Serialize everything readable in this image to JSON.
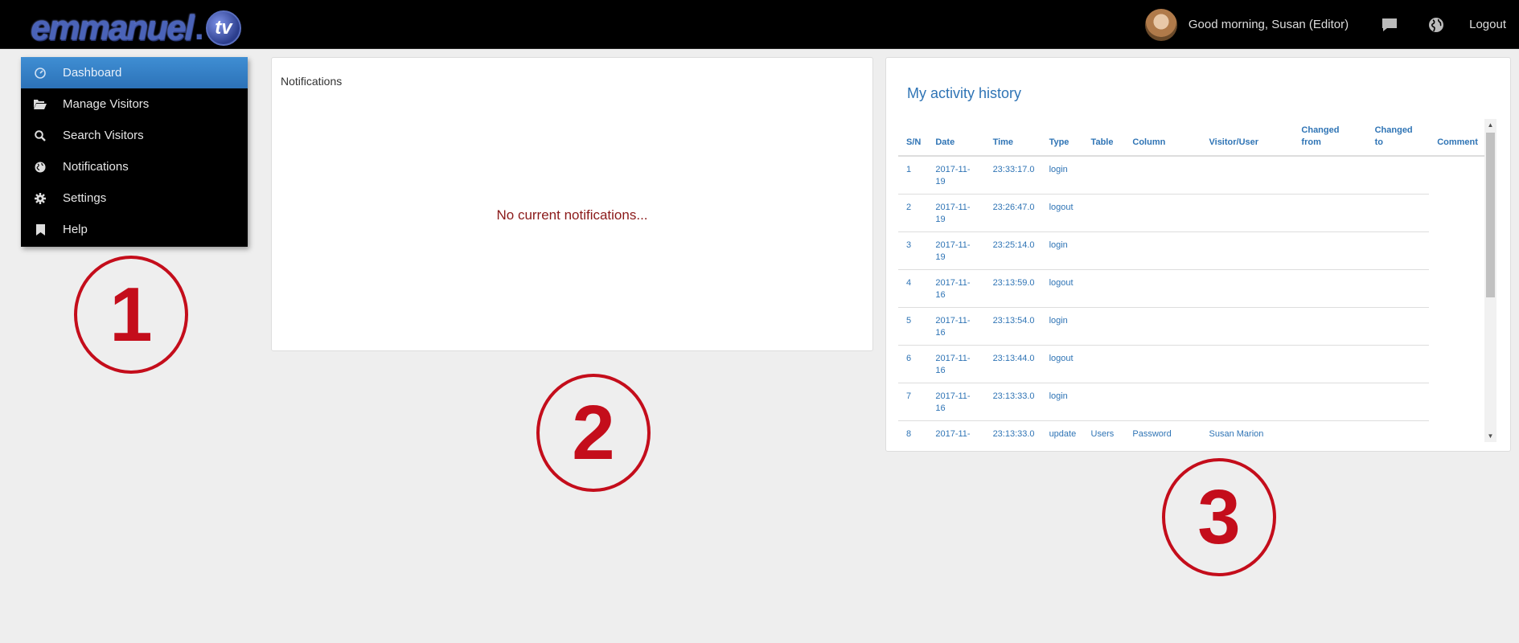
{
  "brand": {
    "name": "emmanuel",
    "suffix": "tv"
  },
  "header": {
    "greeting": "Good morning, Susan (Editor)",
    "logout": "Logout"
  },
  "sidebar": {
    "items": [
      {
        "label": "Dashboard",
        "icon": "dashboard-icon",
        "active": true
      },
      {
        "label": "Manage Visitors",
        "icon": "folder-open-icon"
      },
      {
        "label": "Search Visitors",
        "icon": "search-icon"
      },
      {
        "label": "Notifications",
        "icon": "globe-icon"
      },
      {
        "label": "Settings",
        "icon": "gear-icon"
      },
      {
        "label": "Help",
        "icon": "bookmark-icon"
      }
    ]
  },
  "notifications": {
    "title": "Notifications",
    "empty_message": "No current notifications..."
  },
  "activity": {
    "title": "My activity history",
    "columns": [
      "S/N",
      "Date",
      "Time",
      "Type",
      "Table",
      "Column",
      "Visitor/User",
      "Changed from",
      "Changed to",
      "Comment"
    ],
    "rows": [
      [
        "1",
        "2017-11-19",
        "23:33:17.0",
        "login",
        "",
        "",
        "",
        "",
        "",
        ""
      ],
      [
        "2",
        "2017-11-19",
        "23:26:47.0",
        "logout",
        "",
        "",
        "",
        "",
        "",
        ""
      ],
      [
        "3",
        "2017-11-19",
        "23:25:14.0",
        "login",
        "",
        "",
        "",
        "",
        "",
        ""
      ],
      [
        "4",
        "2017-11-16",
        "23:13:59.0",
        "logout",
        "",
        "",
        "",
        "",
        "",
        ""
      ],
      [
        "5",
        "2017-11-16",
        "23:13:54.0",
        "login",
        "",
        "",
        "",
        "",
        "",
        ""
      ],
      [
        "6",
        "2017-11-16",
        "23:13:44.0",
        "logout",
        "",
        "",
        "",
        "",
        "",
        ""
      ],
      [
        "7",
        "2017-11-16",
        "23:13:33.0",
        "login",
        "",
        "",
        "",
        "",
        "",
        ""
      ],
      [
        "8",
        "2017-11-",
        "23:13:33.0",
        "update",
        "Users",
        "Password",
        "Susan Marion",
        "",
        "",
        ""
      ]
    ]
  },
  "annotations": [
    "1",
    "2",
    "3"
  ],
  "colors": {
    "accent": "#2f74b5",
    "active_nav": "#337ab7",
    "annotation_red": "#c40d1b",
    "empty_text": "#8b1a1a"
  }
}
